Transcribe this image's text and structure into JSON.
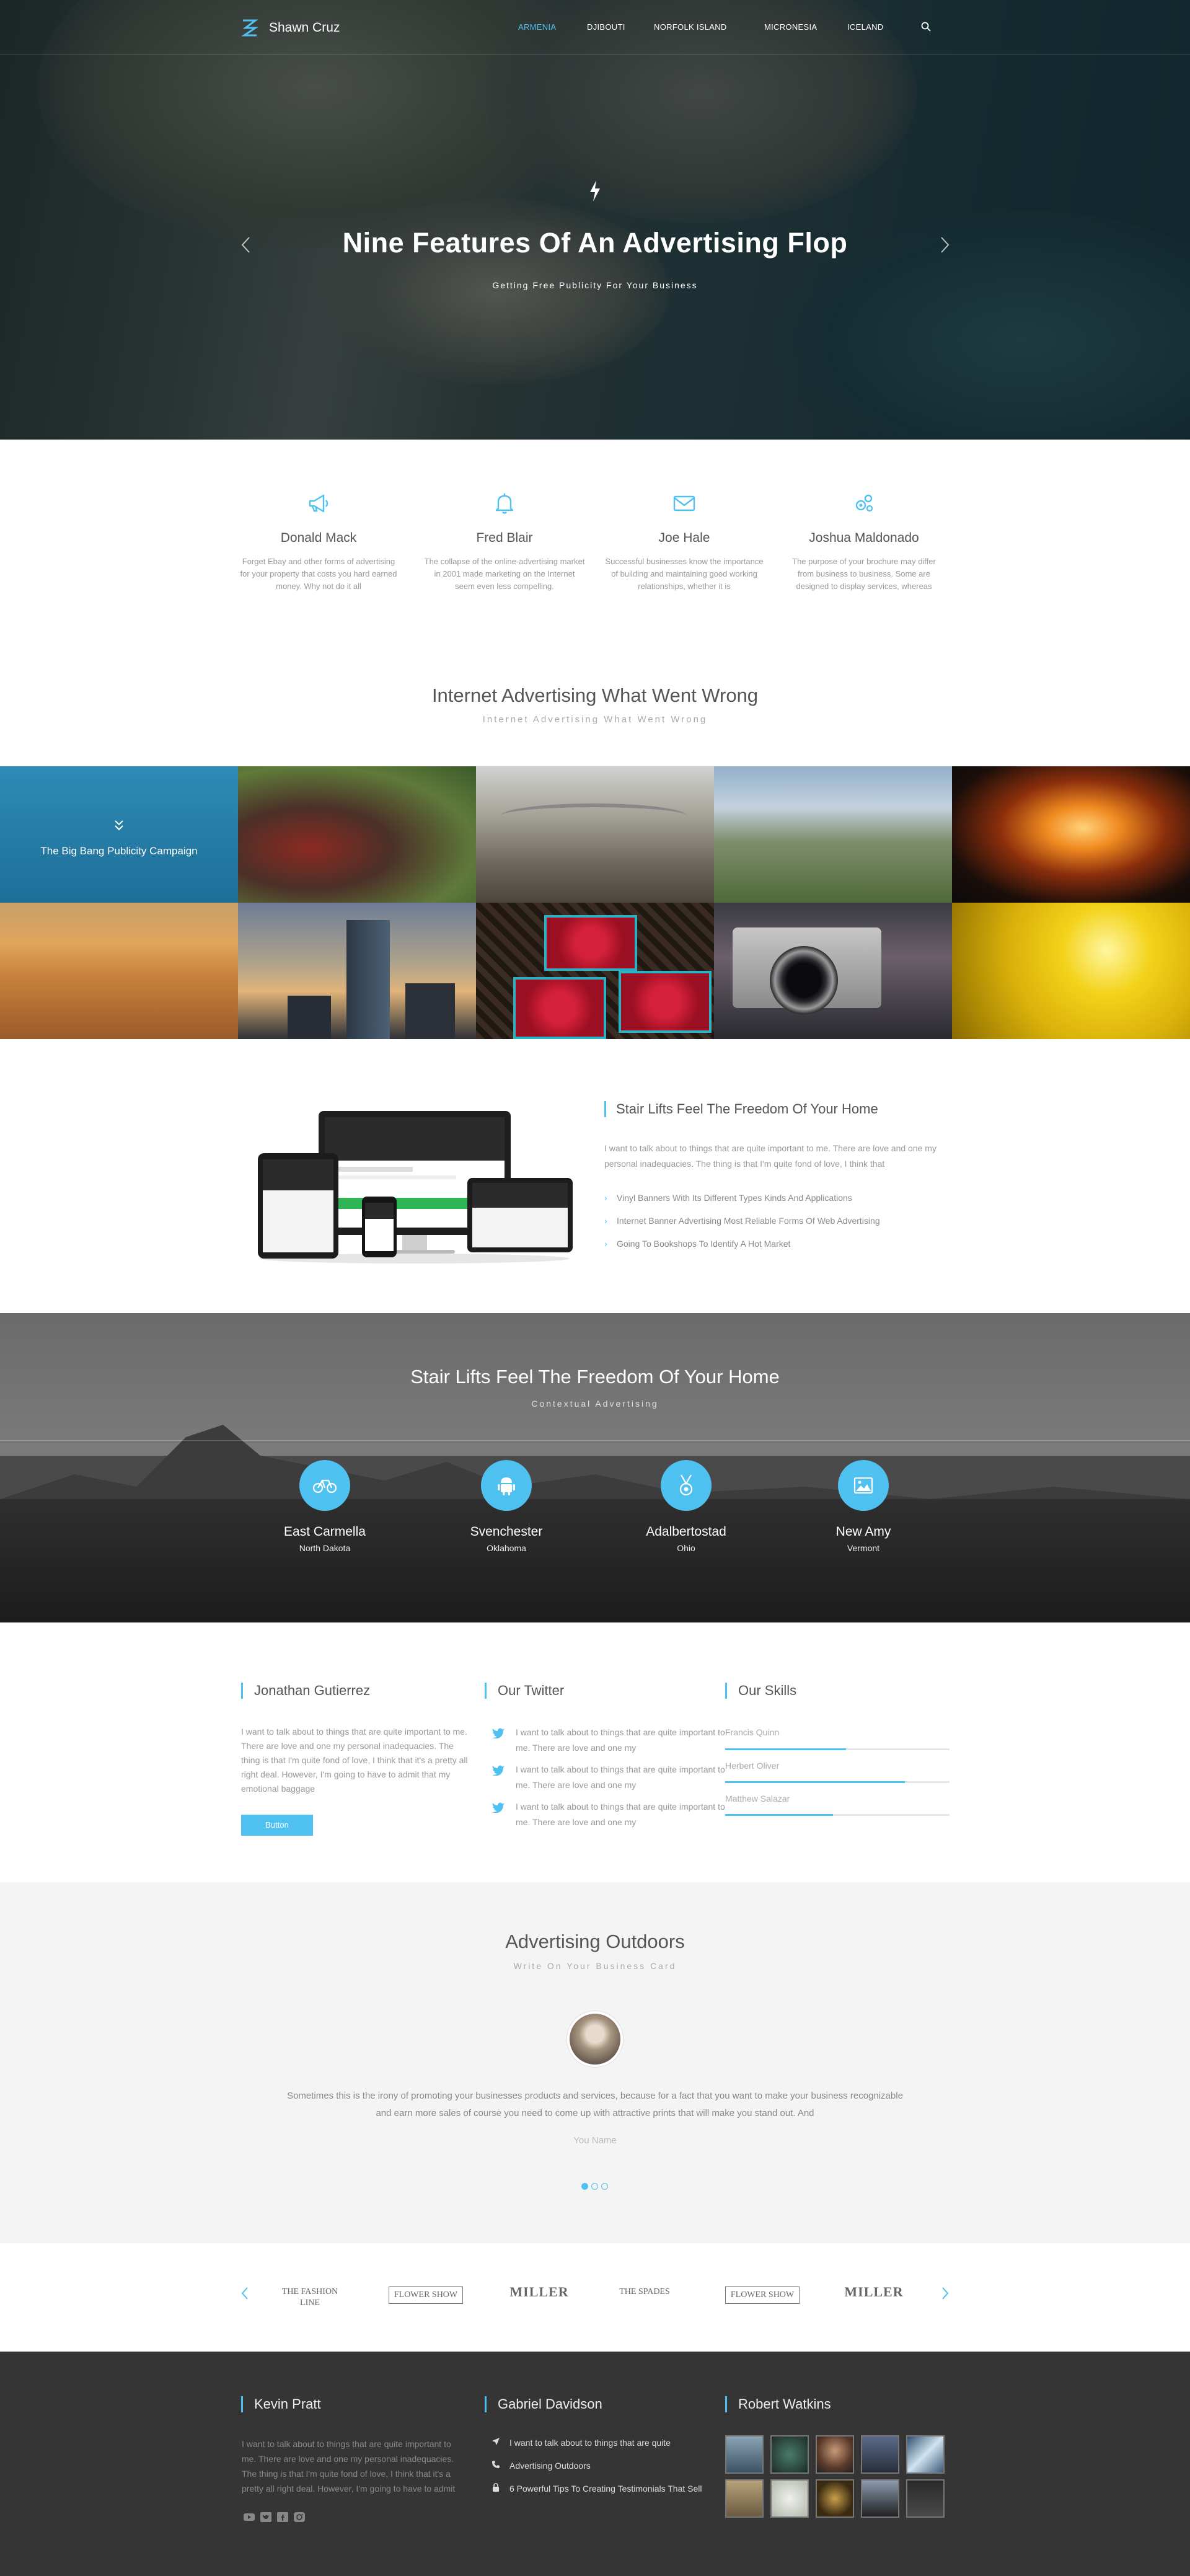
{
  "brand": {
    "name": "Shawn Cruz"
  },
  "nav": {
    "items": [
      "ARMENIA",
      "DJIBOUTI",
      "NORFOLK ISLAND",
      "MICRONESIA",
      "ICELAND"
    ],
    "active": "ARMENIA"
  },
  "hero": {
    "title": "Nine Features Of An Advertising Flop",
    "subtitle": "Getting Free Publicity For Your Business"
  },
  "features": [
    {
      "icon": "megaphone-icon",
      "title": "Donald Mack",
      "text": "Forget Ebay and other forms of advertising for your property that costs you hard earned money. Why not do it all"
    },
    {
      "icon": "bell-icon",
      "title": "Fred Blair",
      "text": "The collapse of the online-advertising market in 2001 made marketing on the Internet seem even less compelling."
    },
    {
      "icon": "envelope-icon",
      "title": "Joe Hale",
      "text": "Successful businesses know the importance of building and maintaining good working relationships, whether it is"
    },
    {
      "icon": "gears-icon",
      "title": "Joshua Maldonado",
      "text": "The purpose of your brochure may differ from business to business. Some are designed to display services, whereas"
    }
  ],
  "gallery_section": {
    "title": "Internet Advertising What Went Wrong",
    "subtitle": "Internet Advertising What Went Wrong",
    "featured_caption": "The Big Bang Publicity Campaign"
  },
  "stair": {
    "title": "Stair Lifts Feel The Freedom Of Your Home",
    "text": "I want to talk about to things that are quite important to me. There are love and one my personal inadequacies. The thing is that I'm quite fond of love, I think that",
    "items": [
      "Vinyl Banners With Its Different Types Kinds And Applications",
      "Internet Banner Advertising Most Reliable Forms Of Web Advertising",
      "Going To Bookshops To Identify A Hot Market"
    ]
  },
  "cities_section": {
    "title": "Stair Lifts Feel The Freedom Of Your Home",
    "subtitle": "Contextual Advertising",
    "cities": [
      {
        "icon": "bicycle-icon",
        "name": "East Carmella",
        "region": "North Dakota"
      },
      {
        "icon": "android-icon",
        "name": "Svenchester",
        "region": "Oklahoma"
      },
      {
        "icon": "medal-icon",
        "name": "Adalbertostad",
        "region": "Ohio"
      },
      {
        "icon": "image-icon",
        "name": "New Amy",
        "region": "Vermont"
      }
    ]
  },
  "about": {
    "title": "Jonathan Gutierrez",
    "text": "I want to talk about to things that are quite important to me. There are love and one my personal inadequacies. The thing is that I'm quite fond of love, I think that it's a pretty all right deal. However, I'm going to have to admit that my emotional baggage",
    "button": "Button"
  },
  "twitter": {
    "title": "Our Twitter",
    "tweets": [
      "I want to talk about to things that are quite important to me. There are love and one my",
      "I want to talk about to things that are quite important to me. There are love and one my",
      "I want to talk about to things that are quite important to me. There are love and one my"
    ]
  },
  "skills": {
    "title": "Our  Skills",
    "items": [
      {
        "name": "Francis Quinn",
        "level": 0.54
      },
      {
        "name": "Herbert Oliver",
        "level": 0.8
      },
      {
        "name": "Matthew Salazar",
        "level": 0.48
      }
    ]
  },
  "testimonial": {
    "title": "Advertising Outdoors",
    "subtitle": "Write On Your Business Card",
    "quote": "Sometimes this is the irony of promoting your businesses products and services, because for a fact that you want to make your business recognizable and earn more sales of course you need to come up with attractive prints that will make you stand out. And",
    "author": "You Name"
  },
  "brands": [
    {
      "name": "THE FASHION LINE"
    },
    {
      "name": "FLOWER SHOW"
    },
    {
      "name": "MILLER"
    },
    {
      "name": "THE SPADES"
    },
    {
      "name": "FLOWER SHOW"
    },
    {
      "name": "MILLER"
    }
  ],
  "footer": {
    "col1": {
      "title": "Kevin Pratt",
      "text": "I want to talk about to things that are quite important to me. There are love and one my personal inadequacies. The thing is that I'm quite fond of love, I think that it's a pretty all right deal. However, I'm going to have to admit"
    },
    "col2": {
      "title": "Gabriel Davidson",
      "links": [
        {
          "icon": "location-arrow-icon",
          "text": "I want to talk about to things that are quite"
        },
        {
          "icon": "phone-icon",
          "text": "Advertising Outdoors"
        },
        {
          "icon": "lock-icon",
          "text": "6 Powerful Tips To Creating Testimonials That Sell"
        }
      ]
    },
    "col3": {
      "title": "Robert Watkins"
    },
    "social": [
      "youtube-icon",
      "twitter-icon",
      "facebook-icon",
      "instagram-icon"
    ]
  },
  "colors": {
    "accent": "#4fc1f0",
    "footer_bg": "#353535",
    "light_bg": "#f4f4f4"
  }
}
